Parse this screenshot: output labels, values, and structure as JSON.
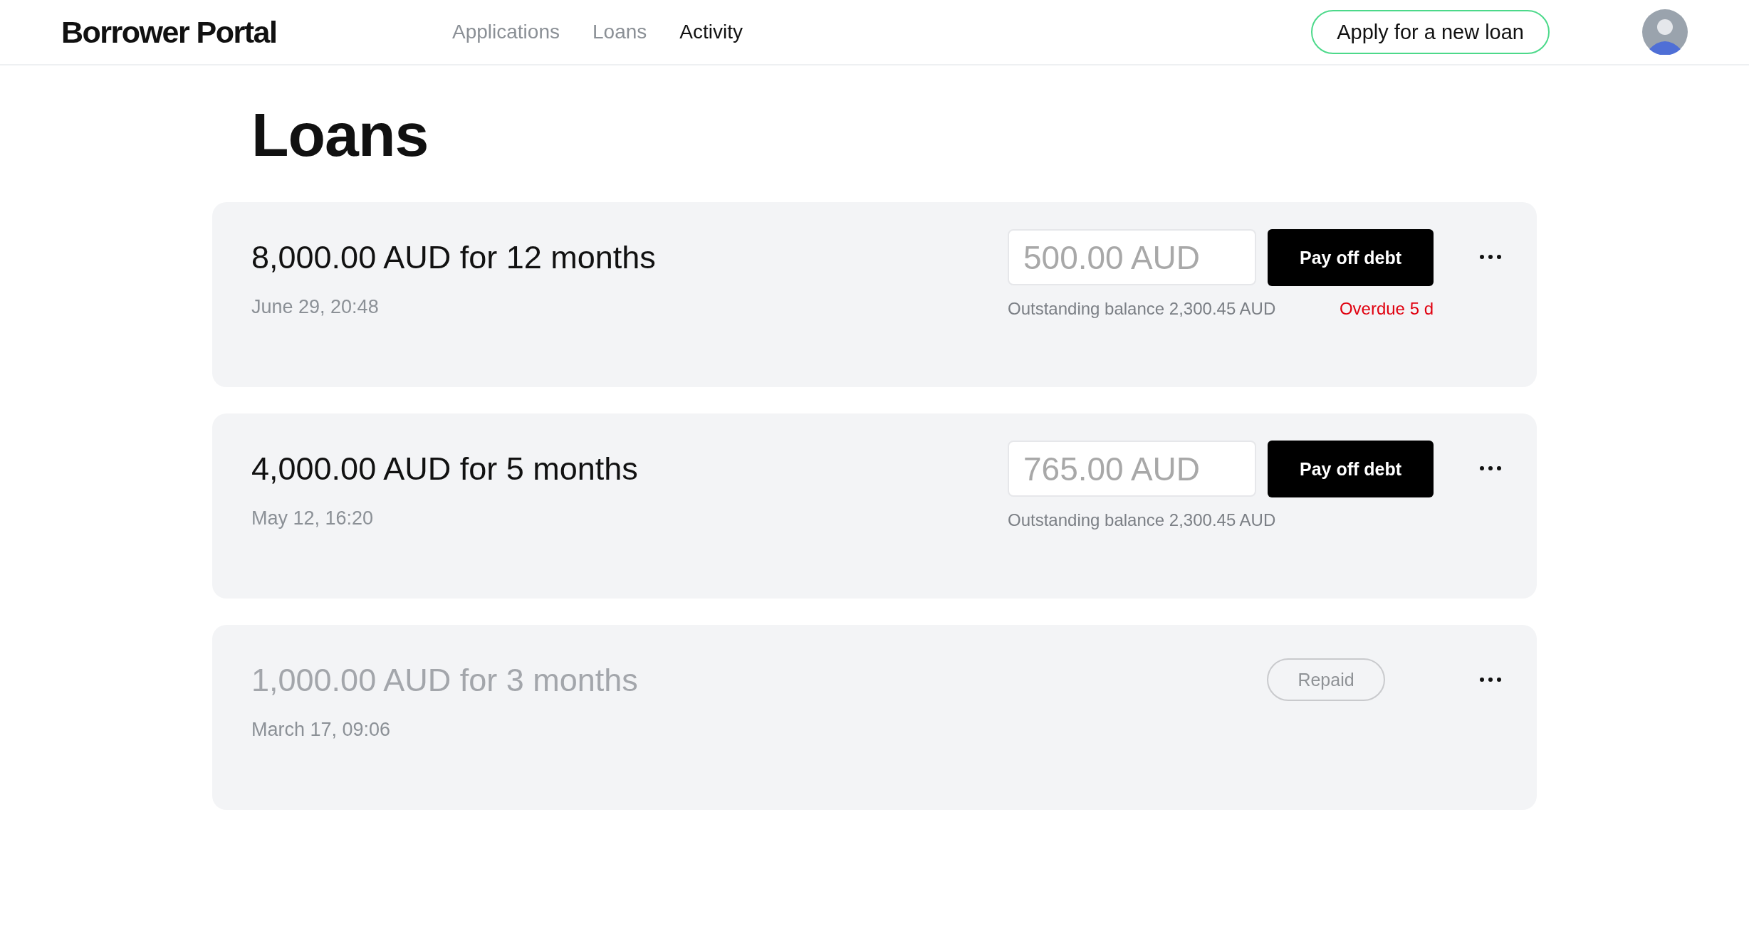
{
  "header": {
    "logo": "Borrower Portal",
    "nav": [
      {
        "label": "Applications",
        "selected": false
      },
      {
        "label": "Loans",
        "selected": false
      },
      {
        "label": "Activity",
        "selected": true
      }
    ],
    "cta": "Apply for a new loan"
  },
  "page_title": "Loans",
  "loans": [
    {
      "kind": "active",
      "title": "8,000.00 AUD for 12 months",
      "date": "June 29, 20:48",
      "amount_placeholder": "500.00 AUD",
      "pay_button": "Pay off debt",
      "balance": "Outstanding balance 2,300.45 AUD",
      "overdue": "Overdue 5 d"
    },
    {
      "kind": "active",
      "title": "4,000.00 AUD for 5 months",
      "date": "May 12, 16:20",
      "amount_placeholder": "765.00 AUD",
      "pay_button": "Pay off debt",
      "balance": "Outstanding balance 2,300.45 AUD"
    },
    {
      "kind": "repaid",
      "title": "1,000.00 AUD for 3 months",
      "date": "March 17, 09:06",
      "status": "Repaid"
    }
  ]
}
